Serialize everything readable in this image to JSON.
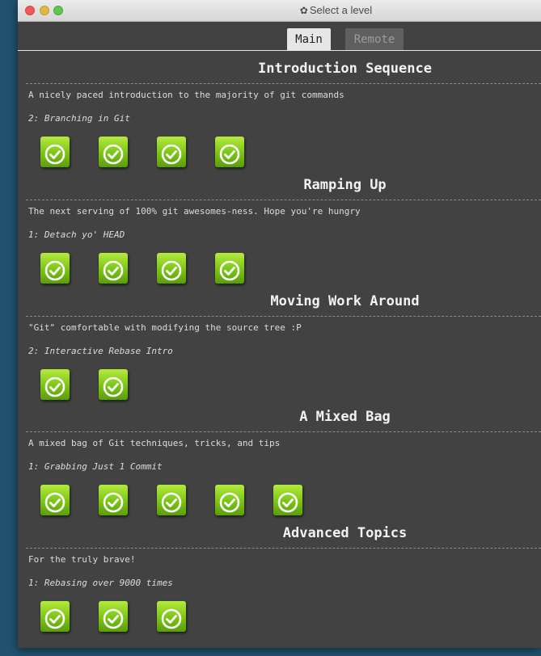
{
  "window": {
    "title": "Select a level",
    "title_icon": "gear-icon"
  },
  "tabs": {
    "main": "Main",
    "remote": "Remote",
    "active": "Main"
  },
  "sections": [
    {
      "title": "Introduction Sequence",
      "description": "A nicely paced introduction to the majority of git commands",
      "subtitle": "2: Branching in Git",
      "levels_completed": 4
    },
    {
      "title": "Ramping Up",
      "description": "The next serving of 100% git awesomes-ness. Hope you're hungry",
      "subtitle": "1: Detach yo' HEAD",
      "levels_completed": 4
    },
    {
      "title": "Moving Work Around",
      "description": "\"Git\" comfortable with modifying the source tree :P",
      "subtitle": "2: Interactive Rebase Intro",
      "levels_completed": 2
    },
    {
      "title": "A Mixed Bag",
      "description": "A mixed bag of Git techniques, tricks, and tips",
      "subtitle": "1: Grabbing Just 1 Commit",
      "levels_completed": 5
    },
    {
      "title": "Advanced Topics",
      "description": "For the truly brave!",
      "subtitle": "1: Rebasing over 9000 times",
      "levels_completed": 3
    }
  ],
  "colors": {
    "level_complete": "#7cc415",
    "window_bg": "#424242",
    "desktop_bg": "#20516f"
  }
}
